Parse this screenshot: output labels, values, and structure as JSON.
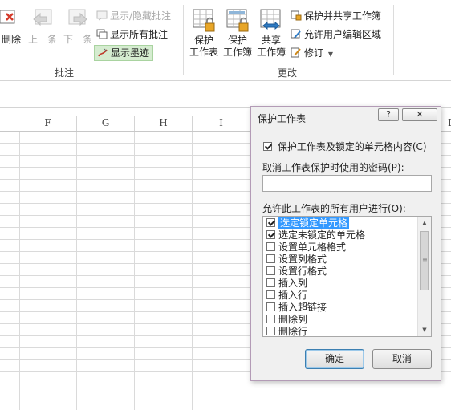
{
  "ribbon": {
    "delete_label": "删除",
    "prev_label": "上一条",
    "next_label": "下一条",
    "show_hide_comment": "显示/隐藏批注",
    "show_all_comments": "显示所有批注",
    "show_ink": "显示墨迹",
    "comments_group": "批注",
    "protect_sheet_line1": "保护",
    "protect_sheet_line2": "工作表",
    "protect_workbook_line1": "保护",
    "protect_workbook_line2": "工作簿",
    "share_workbook_line1": "共享",
    "share_workbook_line2": "工作簿",
    "protect_share_workbook": "保护并共享工作簿",
    "allow_edit_ranges": "允许用户编辑区域",
    "track_changes": "修订",
    "changes_group": "更改"
  },
  "sheet": {
    "columns": [
      "F",
      "G",
      "H",
      "I",
      "L"
    ]
  },
  "dialog": {
    "title": "保护工作表",
    "help": "?",
    "close": "✕",
    "protect_option": "保护工作表及锁定的单元格内容(C)",
    "protect_checked": true,
    "password_label": "取消工作表保护时使用的密码(P):",
    "password_value": "",
    "allow_label": "允许此工作表的所有用户进行(O):",
    "permissions": [
      {
        "label": "选定锁定单元格",
        "checked": true,
        "selected": true
      },
      {
        "label": "选定未锁定的单元格",
        "checked": true,
        "selected": false
      },
      {
        "label": "设置单元格格式",
        "checked": false,
        "selected": false
      },
      {
        "label": "设置列格式",
        "checked": false,
        "selected": false
      },
      {
        "label": "设置行格式",
        "checked": false,
        "selected": false
      },
      {
        "label": "插入列",
        "checked": false,
        "selected": false
      },
      {
        "label": "插入行",
        "checked": false,
        "selected": false
      },
      {
        "label": "插入超链接",
        "checked": false,
        "selected": false
      },
      {
        "label": "删除列",
        "checked": false,
        "selected": false
      },
      {
        "label": "删除行",
        "checked": false,
        "selected": false
      }
    ],
    "ok_label": "确定",
    "cancel_label": "取消"
  },
  "colors": {
    "selection": "#3399ff",
    "ink_highlight": "#d5ecd0",
    "dialog_border": "#b39bb6"
  },
  "icons": [
    "delete-comment-icon",
    "prev-comment-icon",
    "next-comment-icon",
    "show-hide-comment-icon",
    "show-all-comments-icon",
    "show-ink-icon",
    "protect-sheet-icon",
    "protect-workbook-icon",
    "share-workbook-icon",
    "protect-share-icon",
    "allow-edit-icon",
    "track-changes-icon"
  ]
}
